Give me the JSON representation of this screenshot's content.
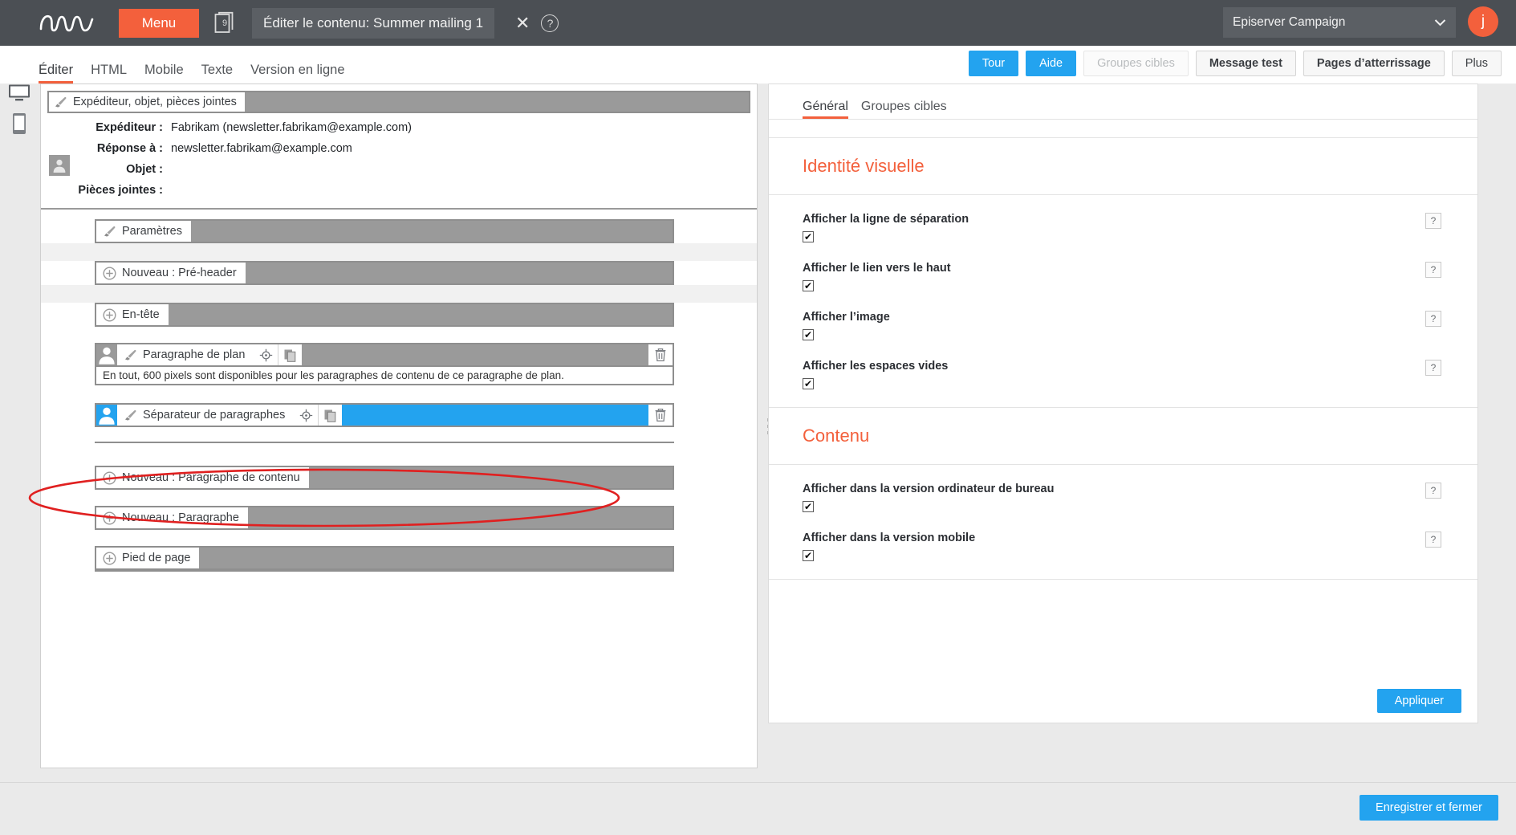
{
  "topbar": {
    "logo_icon": "episerver-logo-icon",
    "menu_label": "Menu",
    "doc_icon": "mailing-stack-icon",
    "doc_badge": "9",
    "title": "Éditer le contenu: Summer mailing 1",
    "close_icon": "close-icon",
    "help_icon": "help-circle-icon",
    "client_name": "Episerver Campaign",
    "chevron_icon": "chevron-down-icon",
    "avatar_initial": "j",
    "bg_color": "#4b4f54",
    "accent_color": "#f3603c"
  },
  "subbar": {
    "tabs": [
      {
        "label": "Éditer",
        "active": true
      },
      {
        "label": "HTML",
        "active": false
      },
      {
        "label": "Mobile",
        "active": false
      },
      {
        "label": "Texte",
        "active": false
      },
      {
        "label": "Version en ligne",
        "active": false
      }
    ],
    "buttons": [
      {
        "label": "Tour",
        "style": "blue"
      },
      {
        "label": "Aide",
        "style": "blue"
      },
      {
        "label": "Groupes cibles",
        "style": "disabled"
      },
      {
        "label": "Message test",
        "style": "grey"
      },
      {
        "label": "Pages d’atterrissage",
        "style": "grey"
      },
      {
        "label": "Plus",
        "style": "grey-plain"
      }
    ]
  },
  "rail": {
    "desktop_icon": "desktop-preview-icon",
    "mobile_icon": "mobile-preview-icon"
  },
  "editor": {
    "sender_section": {
      "header_label": "Expéditeur, objet, pièces jointes",
      "brush_icon": "brush-icon",
      "person_icon": "person-icon",
      "rows": [
        {
          "label": "Expéditeur :",
          "value": "Fabrikam (newsletter.fabrikam@example.com)"
        },
        {
          "label": "Réponse à :",
          "value": "newsletter.fabrikam@example.com"
        },
        {
          "label": "Objet :",
          "value": ""
        },
        {
          "label": "Pièces jointes :",
          "value": ""
        }
      ]
    },
    "settings_row": {
      "label": "Paramètres",
      "brush_icon": "brush-icon"
    },
    "blocks": [
      {
        "type": "new",
        "label": "Nouveau : Pré-header",
        "icon": "plus-circle-icon"
      },
      {
        "type": "new",
        "label": "En-tête",
        "icon": "plus-circle-icon"
      },
      {
        "type": "element",
        "label": "Paragraphe de plan",
        "person_icon": "person-icon",
        "brush_icon": "brush-icon",
        "move_icon": "move-target-icon",
        "copy_icon": "copy-icon",
        "trash_icon": "trash-icon",
        "note": "En tout, 600 pixels sont disponibles pour les paragraphes de contenu de ce paragraphe de plan.",
        "selected": false
      },
      {
        "type": "element",
        "label": "Séparateur de paragraphes",
        "person_icon": "person-icon",
        "brush_icon": "brush-icon",
        "move_icon": "move-target-icon",
        "copy_icon": "copy-icon",
        "trash_icon": "trash-icon",
        "note": "",
        "selected": true
      },
      {
        "type": "new",
        "label": "Nouveau : Paragraphe de contenu",
        "icon": "plus-circle-icon"
      },
      {
        "type": "new",
        "label": "Nouveau : Paragraphe",
        "icon": "plus-circle-icon"
      },
      {
        "type": "new",
        "label": "Pied de page",
        "icon": "plus-circle-icon"
      }
    ]
  },
  "props": {
    "tabs": [
      {
        "label": "Général",
        "active": true
      },
      {
        "label": "Groupes cibles",
        "active": false
      }
    ],
    "sections": [
      {
        "title": "Identité visuelle",
        "fields": [
          {
            "label": "Afficher la ligne de séparation",
            "checked": true,
            "help": "?"
          },
          {
            "label": "Afficher le lien vers le haut",
            "checked": true,
            "help": "?"
          },
          {
            "label": "Afficher l’image",
            "checked": true,
            "help": "?"
          },
          {
            "label": "Afficher les espaces vides",
            "checked": true,
            "help": "?"
          }
        ]
      },
      {
        "title": "Contenu",
        "fields": [
          {
            "label": "Afficher dans la version ordinateur de bureau",
            "checked": true,
            "help": "?"
          },
          {
            "label": "Afficher dans la version mobile",
            "checked": true,
            "help": "?"
          }
        ]
      }
    ],
    "apply_label": "Appliquer",
    "section_color": "#f3603c"
  },
  "footer": {
    "save_label": "Enregistrer et fermer",
    "button_color": "#23a3ef"
  },
  "annotation": {
    "shape": "red-ellipse-highlight",
    "color": "#e02020"
  }
}
